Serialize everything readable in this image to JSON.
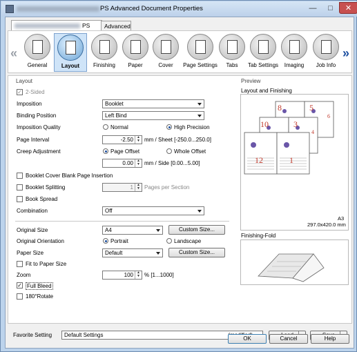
{
  "window": {
    "title": "PS Advanced Document Properties",
    "title_prefix_blurred": true,
    "close_glyph": "✕",
    "min_glyph": "—",
    "max_glyph": "□"
  },
  "tabs": [
    {
      "label": "PS",
      "selected": true
    },
    {
      "label": "Advanced",
      "selected": false
    }
  ],
  "features": [
    {
      "label": "General",
      "icon": "general-icon"
    },
    {
      "label": "Layout",
      "icon": "layout-icon",
      "selected": true
    },
    {
      "label": "Finishing",
      "icon": "finishing-icon"
    },
    {
      "label": "Paper",
      "icon": "paper-icon"
    },
    {
      "label": "Cover",
      "icon": "cover-icon"
    },
    {
      "label": "Page Settings",
      "icon": "page-settings-icon"
    },
    {
      "label": "Tabs",
      "icon": "tabs-icon"
    },
    {
      "label": "Tab Settings",
      "icon": "tab-settings-icon"
    },
    {
      "label": "Imaging",
      "icon": "imaging-icon"
    },
    {
      "label": "Job Info",
      "icon": "job-info-icon"
    }
  ],
  "nav": {
    "left": "«",
    "right": "»"
  },
  "layout": {
    "section_title": "Layout",
    "two_sided": "2-Sided",
    "imposition_label": "Imposition",
    "imposition_value": "Booklet",
    "binding_label": "Binding Position",
    "binding_value": "Left Bind",
    "quality_label": "Imposition Quality",
    "quality_normal": "Normal",
    "quality_high": "High Precision",
    "page_interval_label": "Page Interval",
    "page_interval_value": "-2.50",
    "page_interval_unit": "mm / Sheet [-250.0...250.0]",
    "creep_label": "Creep Adjustment",
    "creep_page_offset": "Page Offset",
    "creep_whole_offset": "Whole Offset",
    "creep_value": "0.00",
    "creep_unit": "mm / Side [0.00...5.00]",
    "booklet_cover": "Booklet Cover Blank Page Insertion",
    "booklet_split": "Booklet Splitting",
    "split_value": "1",
    "split_unit": "Pages per Section",
    "book_spread": "Book Spread",
    "combination_label": "Combination",
    "combination_value": "Off"
  },
  "original": {
    "size_label": "Original Size",
    "size_value": "A4",
    "custom_size": "Custom Size...",
    "orientation_label": "Original Orientation",
    "portrait": "Portrait",
    "landscape": "Landscape",
    "paper_size_label": "Paper Size",
    "paper_size_value": "Default",
    "custom_size2": "Custom Size...",
    "fit": "Fit to Paper Size",
    "zoom_label": "Zoom",
    "zoom_value": "100",
    "zoom_unit": "% [1...1000]",
    "full_bleed": "Full Bleed",
    "rotate": "180°Rotate"
  },
  "preview": {
    "section_title": "Preview",
    "layout_finishing": "Layout and Finishing",
    "paper": "A3",
    "paper_dims": "297.0x420.0 mm",
    "finishing_fold": "Finishing-Fold",
    "page_numbers": {
      "a": "8",
      "b": "5",
      "c": "6",
      "d": "10",
      "e": "3",
      "f": "4",
      "g": "12",
      "h": "1"
    }
  },
  "bottom": {
    "favorite_label": "Favorite Setting",
    "favorite_value": "Default Settings",
    "modified": "(modified)",
    "load": "Load",
    "save": "Save",
    "ok": "OK",
    "cancel": "Cancel",
    "help": "Help"
  },
  "colors": {
    "accent": "#1c4fa0",
    "selected_bg": "#cfe4f8",
    "page_number": "#c0392b"
  }
}
